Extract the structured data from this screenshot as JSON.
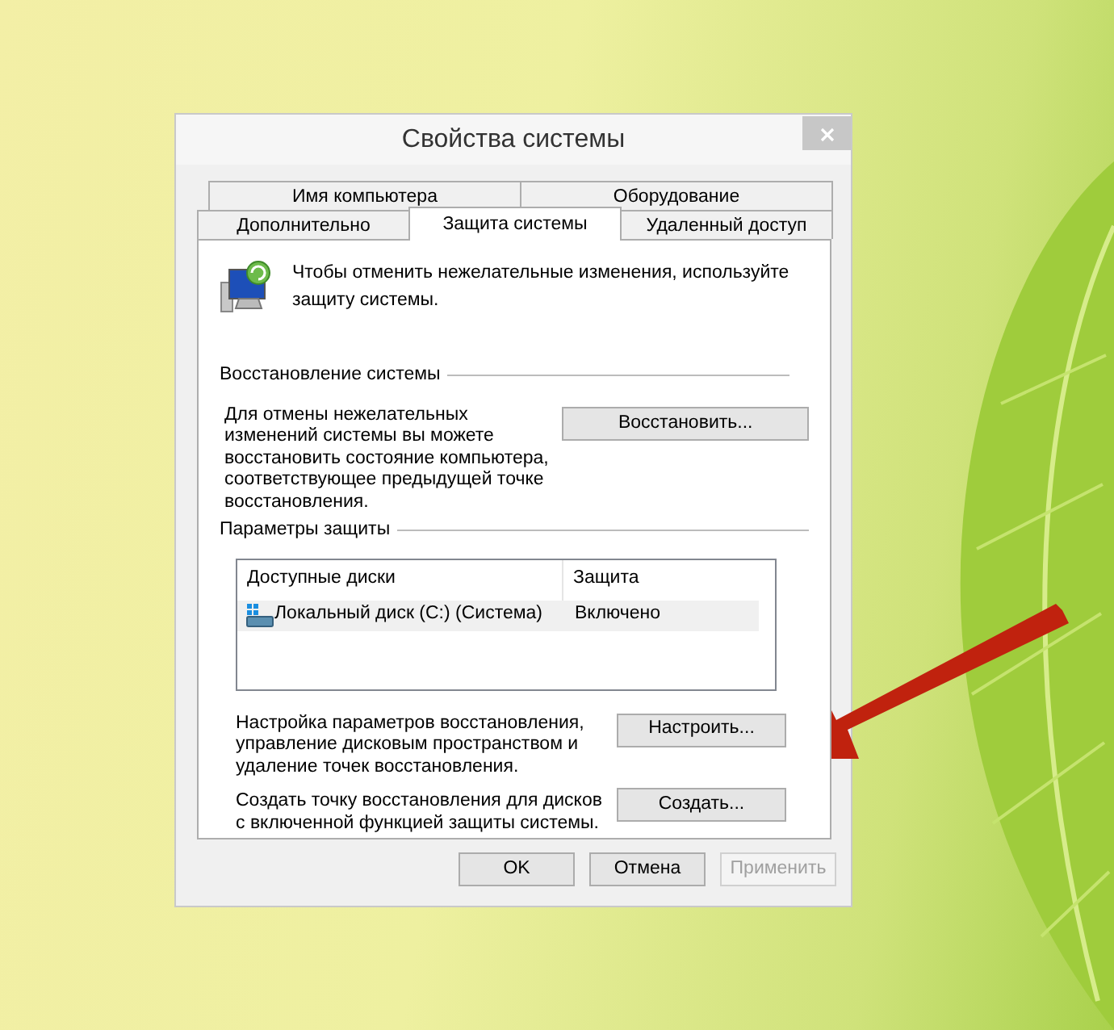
{
  "window": {
    "title": "Свойства системы"
  },
  "tab_rows": [
    [
      {
        "label": "Имя компьютера",
        "selected": false
      },
      {
        "label": "Оборудование",
        "selected": false
      }
    ],
    [
      {
        "label": "Дополнительно",
        "selected": false
      },
      {
        "label": "Защита системы",
        "selected": true
      },
      {
        "label": "Удаленный доступ",
        "selected": false
      }
    ]
  ],
  "intro": "Чтобы отменить нежелательные изменения, используйте защиту системы.",
  "restore": {
    "heading": "Восстановление системы",
    "text": "Для отмены нежелательных изменений системы вы можете восстановить состояние компьютера, соответствующее предыдущей точке восстановления.",
    "button": "Восстановить..."
  },
  "protection": {
    "heading": "Параметры защиты",
    "columns": [
      "Доступные диски",
      "Защита"
    ],
    "rows": [
      {
        "disk": "Локальный диск (C:) (Система)",
        "protection": "Включено",
        "selected": true
      }
    ],
    "configure_text": "Настройка параметров восстановления, управление дисковым пространством и удаление точек восстановления.",
    "configure_button": "Настроить...",
    "create_text": "Создать точку восстановления для дисков с включенной функцией защиты системы.",
    "create_button": "Создать..."
  },
  "buttons": [
    {
      "label": "OK",
      "disabled": false
    },
    {
      "label": "Отмена",
      "disabled": false
    },
    {
      "label": "Применить",
      "disabled": true
    }
  ]
}
